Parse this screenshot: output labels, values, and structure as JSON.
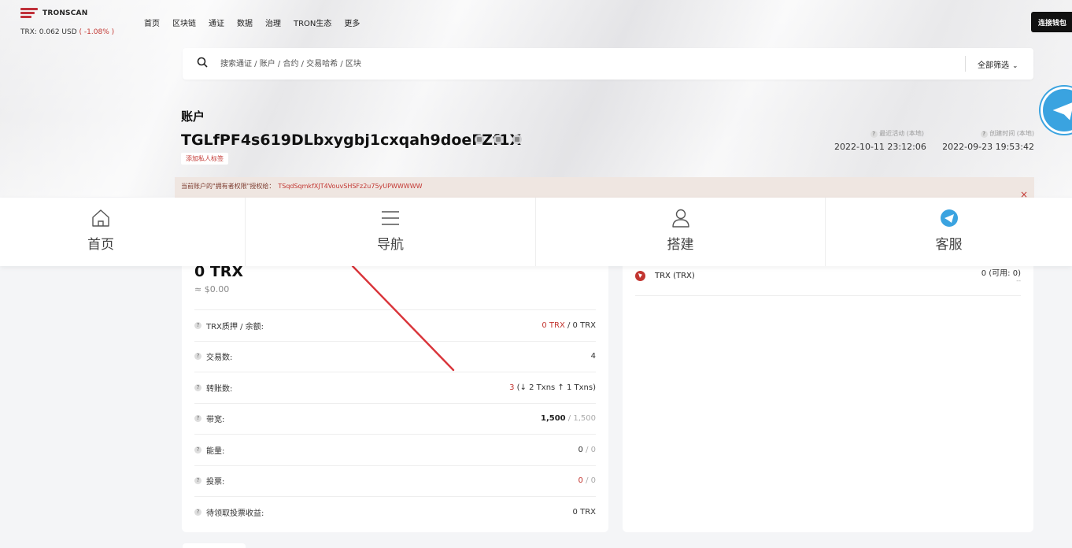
{
  "topbar": {
    "logo_text": "TRONSCAN",
    "price_label": "TRX: 0.062 USD",
    "price_change": "( -1.08% )",
    "nav": [
      "首页",
      "区块链",
      "通证",
      "数据",
      "治理",
      "TRON生态",
      "更多"
    ],
    "connect_label": "连接钱包"
  },
  "search": {
    "placeholder": "搜索通证 / 账户 / 合约 / 交易哈希 / 区块",
    "filter_label": "全部筛选"
  },
  "account": {
    "title": "账户",
    "address": "TGLfPF4s619DLbxygbj1cxqah9doeFZf1X",
    "tag_label": "添加私人标签",
    "last_active_label": "最近活动 (本地)",
    "last_active_value": "2022-10-11 23:12:06",
    "created_label": "创建时间 (本地)",
    "created_value": "2022-09-23 19:53:42"
  },
  "notice": {
    "text": "当前账户的\"拥有者权限\"授权给：",
    "address": "TSqdSqmkfXJT4VouvSHSFz2u75yUPWWWWW",
    "close": "×"
  },
  "bottom_nav": [
    {
      "label": "首页",
      "icon": "home-icon"
    },
    {
      "label": "导航",
      "icon": "menu-icon"
    },
    {
      "label": "搭建",
      "icon": "user-icon"
    },
    {
      "label": "客服",
      "icon": "telegram-icon"
    }
  ],
  "balance": {
    "amount": "0 TRX",
    "usd": "≈ $0.00"
  },
  "stats": [
    {
      "label": "TRX质押 / 余额:",
      "value_main": "0 TRX",
      "value_sep": " / ",
      "value_sub": "0 TRX",
      "style": "red-main"
    },
    {
      "label": "交易数:",
      "value_main": "4",
      "style": "red"
    },
    {
      "label": "转账数:",
      "value_main": "3",
      "value_detail": "(↓ 2 Txns ↑ 1 Txns)",
      "style": "red-main"
    },
    {
      "label": "带宽:",
      "value_main": "1,500",
      "value_sep": " / ",
      "value_sub": "1,500",
      "style": "bold-muted"
    },
    {
      "label": "能量:",
      "value_main": "0",
      "value_sep": " / ",
      "value_sub": "0",
      "style": "plain-muted"
    },
    {
      "label": "投票:",
      "value_main": "0",
      "value_sep": " / ",
      "value_sub": "0",
      "style": "red-muted"
    },
    {
      "label": "待领取投票收益:",
      "value_main": "0 TRX",
      "style": "plain"
    }
  ],
  "tokens": [
    {
      "name": "TRX (TRX)",
      "amount": "0 (可用: 0)",
      "sub": "--"
    }
  ],
  "colors": {
    "accent_red": "#c23631",
    "telegram_blue": "#3aa3e0",
    "dark": "#111111"
  }
}
